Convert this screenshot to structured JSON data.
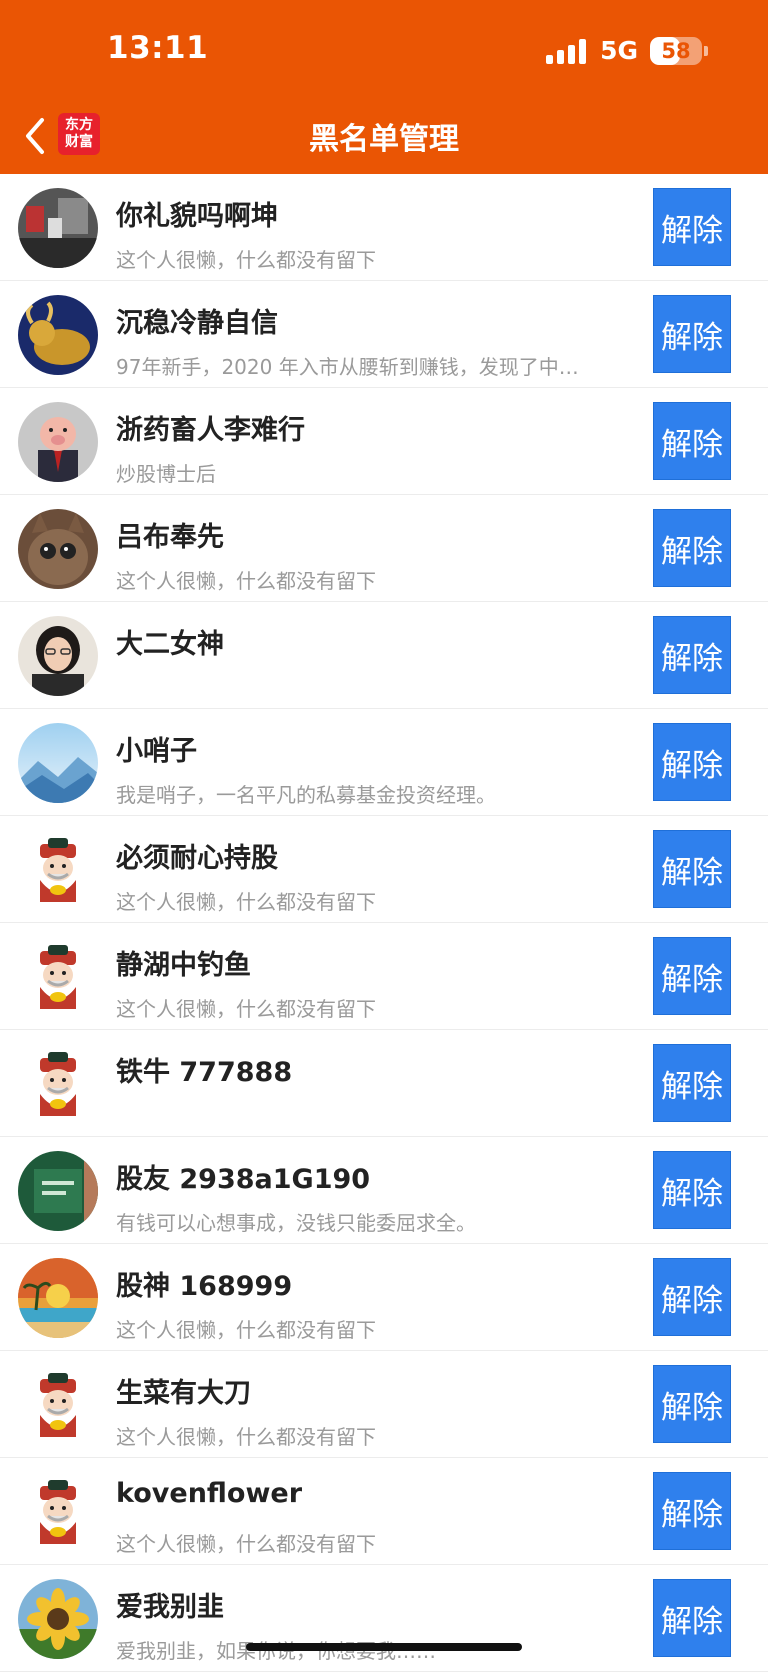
{
  "status": {
    "time": "13:11",
    "network": "5G",
    "battery": "58"
  },
  "nav": {
    "logo_line1": "东方",
    "logo_line2": "财富",
    "title": "黑名单管理"
  },
  "colors": {
    "header": "#ea5504",
    "button": "#2f80ed"
  },
  "button_label": "解除",
  "users": [
    {
      "name": "你礼貌吗啊坤",
      "bio": "这个人很懒，什么都没有留下",
      "avatar": "photo-room"
    },
    {
      "name": "沉稳冷静自信",
      "bio": "97年新手，2020 年入市从腰斩到赚钱，发现了中…",
      "avatar": "golden-bull"
    },
    {
      "name": "浙药畜人李难行",
      "bio": "炒股博士后",
      "avatar": "pig-man"
    },
    {
      "name": "吕布奉先",
      "bio": "这个人很懒，什么都没有留下",
      "avatar": "cat"
    },
    {
      "name": "大二女神",
      "bio": "",
      "avatar": "woman-portrait"
    },
    {
      "name": "小哨子",
      "bio": "我是哨子，一名平凡的私募基金投资经理。",
      "avatar": "mountains"
    },
    {
      "name": "必须耐心持股",
      "bio": "这个人很懒，什么都没有留下",
      "avatar": "fortune-god"
    },
    {
      "name": "静湖中钓鱼",
      "bio": "这个人很懒，什么都没有留下",
      "avatar": "fortune-god"
    },
    {
      "name": "铁牛 777888",
      "bio": "",
      "avatar": "fortune-god"
    },
    {
      "name": "股友 2938a1G190",
      "bio": "有钱可以心想事成，没钱只能委屈求全。",
      "avatar": "green-book"
    },
    {
      "name": "股神 168999",
      "bio": "这个人很懒，什么都没有留下",
      "avatar": "sunset-painting"
    },
    {
      "name": "生菜有大刀",
      "bio": "这个人很懒，什么都没有留下",
      "avatar": "fortune-god"
    },
    {
      "name": "kovenflower",
      "bio": "这个人很懒，什么都没有留下",
      "avatar": "fortune-god"
    },
    {
      "name": "爱我别韭",
      "bio": "爱我别韭，如果你说，你想要我……",
      "avatar": "sunflower"
    }
  ]
}
